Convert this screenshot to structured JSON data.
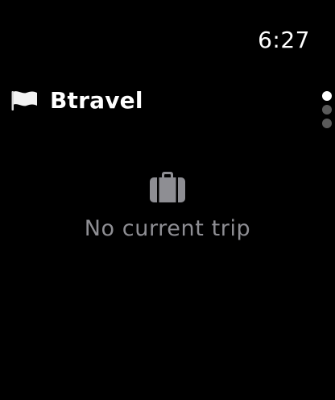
{
  "status_bar": {
    "time": "6:27"
  },
  "header": {
    "icon": "flag-icon",
    "title": "Btravel"
  },
  "page_indicator": {
    "pages": 3,
    "current": 1
  },
  "empty_state": {
    "icon": "suitcase-icon",
    "message": "No current trip"
  },
  "colors": {
    "background": "#000000",
    "title": "#ffffff",
    "secondary_text": "#8e8e93",
    "icon": "#8e8e93",
    "dot_active": "#ffffff",
    "dot_inactive": "#5a5a5a"
  }
}
